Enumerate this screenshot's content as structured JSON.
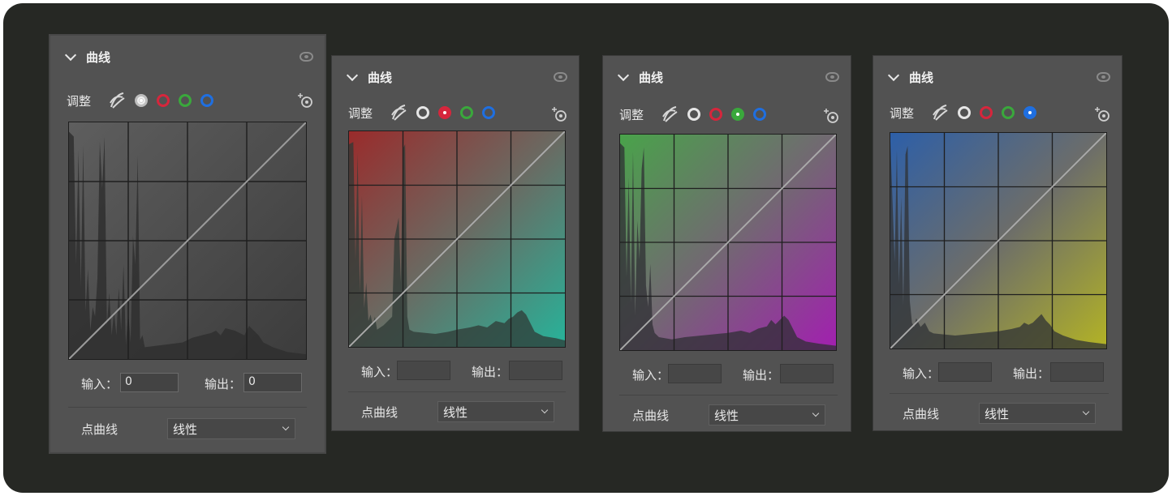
{
  "panels": [
    {
      "title": "曲线",
      "adjust_label": "调整",
      "selected_channel": "rgb",
      "input_label": "输入：",
      "input_value": "0",
      "output_label": "输出：",
      "output_value": "0",
      "point_curve_label": "点曲线",
      "curve_mode": "线性"
    },
    {
      "title": "曲线",
      "adjust_label": "调整",
      "selected_channel": "red",
      "input_label": "输入：",
      "input_value": "",
      "output_label": "输出：",
      "output_value": "",
      "point_curve_label": "点曲线",
      "curve_mode": "线性"
    },
    {
      "title": "曲线",
      "adjust_label": "调整",
      "selected_channel": "green",
      "input_label": "输入：",
      "input_value": "",
      "output_label": "输出：",
      "output_value": "",
      "point_curve_label": "点曲线",
      "curve_mode": "线性"
    },
    {
      "title": "曲线",
      "adjust_label": "调整",
      "selected_channel": "blue",
      "input_label": "输入：",
      "input_value": "",
      "output_label": "输出：",
      "output_value": "",
      "point_curve_label": "点曲线",
      "curve_mode": "线性"
    }
  ],
  "icons": {
    "collapse": "chevron-down-icon",
    "visibility": "eye-icon",
    "auto": "auto-tone-icon",
    "picker": "targeted-adjustment-icon"
  },
  "colors": {
    "background": "#262824",
    "panel": "#525252",
    "red": "#d6263c",
    "green": "#3aa83c",
    "blue": "#1f6fe0",
    "red_gradient": [
      "#9a2b2b",
      "#27b39a"
    ],
    "green_gradient": [
      "#49a34a",
      "#a21fb0"
    ],
    "blue_gradient": [
      "#2d5fa8",
      "#b3b325"
    ]
  }
}
